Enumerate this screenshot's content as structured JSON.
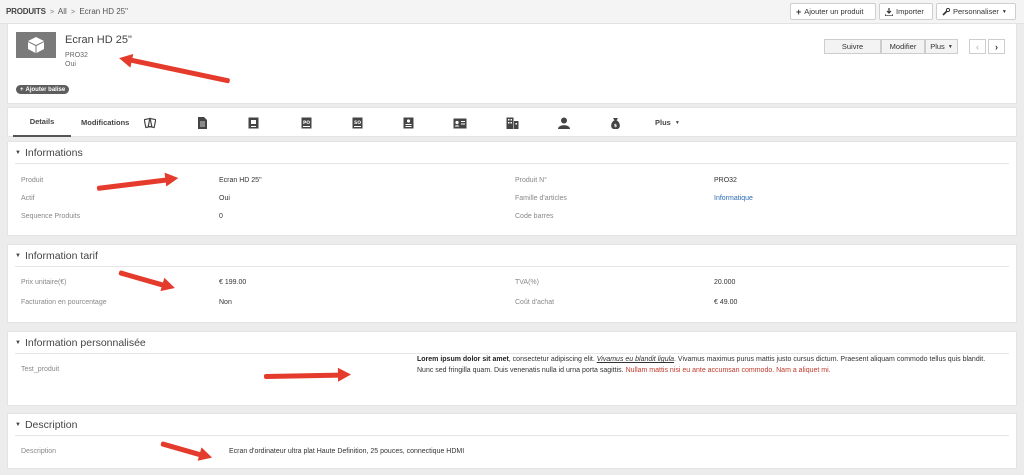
{
  "breadcrumb": {
    "root": "PRODUITS",
    "sep": ">",
    "level1": "All",
    "current": "Ecran HD 25\""
  },
  "toolbar": {
    "add_product": "Ajouter un produit",
    "import": "Importer",
    "customize": "Personnaliser"
  },
  "record": {
    "title": "Ecran HD 25\"",
    "code": "PRO32",
    "active": "Oui",
    "add_tag": "Ajouter balise",
    "follow": "Suivre",
    "edit": "Modifier",
    "more": "Plus"
  },
  "tabs": {
    "details": "Details",
    "modifications": "Modifications",
    "more": "Plus"
  },
  "tab_icons": [
    "tickets-icon",
    "document-icon",
    "invoice-icon",
    "purchase-order-icon",
    "sales-order-icon",
    "quote-icon",
    "contact-card-icon",
    "buildings-icon",
    "person-icon",
    "money-bag-icon"
  ],
  "informations": {
    "title": "Informations",
    "product_label": "Produit",
    "product_value": "Ecran HD 25\"",
    "active_label": "Actif",
    "active_value": "Oui",
    "sequence_label": "Sequence Produits",
    "sequence_value": "0",
    "number_label": "Produit N°",
    "number_value": "PRO32",
    "family_label": "Famille d'articles",
    "family_value": "Informatique",
    "barcode_label": "Code barres",
    "barcode_value": ""
  },
  "tarif": {
    "title": "Information tarif",
    "unit_price_label": "Prix unitaire(€)",
    "unit_price_value": "€ 199.00",
    "percent_billing_label": "Facturation en pourcentage",
    "percent_billing_value": "Non",
    "tva_label": "TVA(%)",
    "tva_value": "20.000",
    "cost_label": "Coût d'achat",
    "cost_value": "€ 49.00"
  },
  "custom": {
    "title": "Information personnalisée",
    "field_label": "Test_produit",
    "text_bold": "Lorem ipsum dolor sit amet",
    "text_1": ", consectetur adipiscing elit. ",
    "text_italic": "Vivamus eu blandit ligula",
    "text_2": ". Vivamus maximus purus mattis justo cursus dictum. Praesent aliquam commodo tellus quis blandit. Nunc sed fringilla quam. Duis venenatis nulla id urna porta sagittis. ",
    "text_red": "Nullam mattis nisi eu ante accumsan commodo. Nam a aliquet mi."
  },
  "description": {
    "title": "Description",
    "label": "Description",
    "value": "Ecran d'ordinateur ultra plat Haute Definition, 25 pouces, connectique HDMI"
  },
  "colors": {
    "accent_arrow": "#e53b2c",
    "link": "#2a6db3",
    "red_text": "#c0392b",
    "image_bg": "#7a7a7a"
  }
}
